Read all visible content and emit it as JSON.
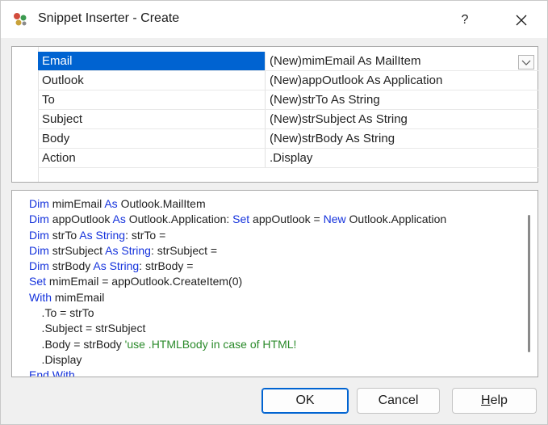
{
  "window": {
    "title": "Snippet Inserter - Create",
    "help_label": "?"
  },
  "grid": {
    "rows": [
      {
        "name": "Email",
        "value": "(New)mimEmail As MailItem",
        "selected": true
      },
      {
        "name": "Outlook",
        "value": "(New)appOutlook As Application"
      },
      {
        "name": "To",
        "value": "(New)strTo As String"
      },
      {
        "name": "Subject",
        "value": "(New)strSubject As String"
      },
      {
        "name": "Body",
        "value": "(New)strBody As String"
      },
      {
        "name": "Action",
        "value": ".Display"
      }
    ]
  },
  "code": {
    "lines": [
      [
        {
          "t": "Dim",
          "k": "kw"
        },
        {
          "t": " mimEmail "
        },
        {
          "t": "As",
          "k": "kw"
        },
        {
          "t": " Outlook.MailItem"
        }
      ],
      [
        {
          "t": "Dim",
          "k": "kw"
        },
        {
          "t": " appOutlook "
        },
        {
          "t": "As",
          "k": "kw"
        },
        {
          "t": " Outlook.Application: "
        },
        {
          "t": "Set",
          "k": "kw"
        },
        {
          "t": " appOutlook = "
        },
        {
          "t": "New",
          "k": "kw"
        },
        {
          "t": " Outlook.Application"
        }
      ],
      [
        {
          "t": "Dim",
          "k": "kw"
        },
        {
          "t": " strTo "
        },
        {
          "t": "As",
          "k": "kw"
        },
        {
          "t": " "
        },
        {
          "t": "String",
          "k": "kw"
        },
        {
          "t": ": strTo ="
        }
      ],
      [
        {
          "t": "Dim",
          "k": "kw"
        },
        {
          "t": " strSubject "
        },
        {
          "t": "As",
          "k": "kw"
        },
        {
          "t": " "
        },
        {
          "t": "String",
          "k": "kw"
        },
        {
          "t": ": strSubject ="
        }
      ],
      [
        {
          "t": "Dim",
          "k": "kw"
        },
        {
          "t": " strBody "
        },
        {
          "t": "As",
          "k": "kw"
        },
        {
          "t": " "
        },
        {
          "t": "String",
          "k": "kw"
        },
        {
          "t": ": strBody ="
        }
      ],
      [
        {
          "t": "Set",
          "k": "kw"
        },
        {
          "t": " mimEmail = appOutlook.CreateItem(0)"
        }
      ],
      [
        {
          "t": "With",
          "k": "kw"
        },
        {
          "t": " mimEmail"
        }
      ],
      [
        {
          "t": "    .To = strTo"
        }
      ],
      [
        {
          "t": "    .Subject = strSubject"
        }
      ],
      [
        {
          "t": "    .Body = strBody "
        },
        {
          "t": "'use .HTMLBody in case of HTML!",
          "k": "cm"
        }
      ],
      [
        {
          "t": "    .Display"
        }
      ],
      [
        {
          "t": "End With",
          "k": "kw"
        }
      ]
    ]
  },
  "buttons": {
    "ok": "OK",
    "cancel": "Cancel",
    "help_prefix": "",
    "help_underlined": "H",
    "help_rest": "elp"
  },
  "colors": {
    "keyword": "#1432dc",
    "comment": "#2a8a2a",
    "selection": "#0063d1"
  }
}
